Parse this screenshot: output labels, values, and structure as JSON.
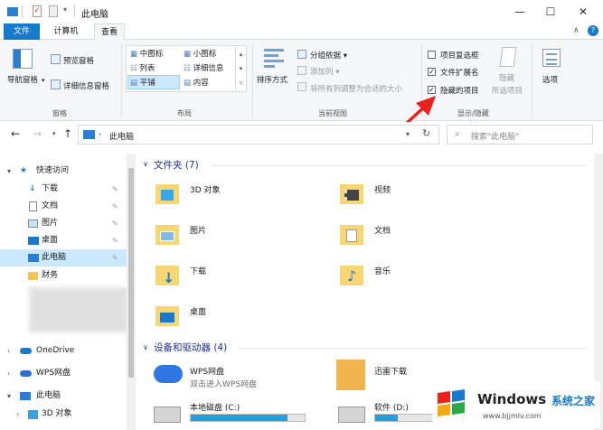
{
  "window": {
    "title": "此电脑"
  },
  "tabs": [
    {
      "label": "文件"
    },
    {
      "label": "计算机"
    },
    {
      "label": "查看"
    }
  ],
  "ribbon": {
    "panes": {
      "label": "窗格",
      "nav_pane": "导航窗格",
      "preview_pane": "预览窗格",
      "details_pane": "详细信息窗格"
    },
    "layout": {
      "label": "布局",
      "items": [
        "中图标",
        "小图标",
        "列表",
        "详细信息",
        "平铺",
        "内容"
      ]
    },
    "current_view": {
      "label": "当前视图",
      "sort_by": "排序方式",
      "group_by": "分组依据",
      "add_column": "添加列",
      "fit_columns": "将所有列调整为合适的大小"
    },
    "show_hide": {
      "label": "显示/隐藏",
      "item_checkboxes": "项目复选框",
      "file_extensions": "文件扩展名",
      "hidden_items": "隐藏的项目",
      "hide": "隐藏",
      "selected_items": "所选项目",
      "options": "选项"
    }
  },
  "checkboxes": {
    "item_checkboxes": false,
    "file_extensions": true,
    "hidden_items": true
  },
  "address": {
    "path": "此电脑",
    "search_placeholder": "搜索\"此电脑\""
  },
  "nav": {
    "items": [
      {
        "label": "快速访问"
      },
      {
        "label": "下载"
      },
      {
        "label": "文档"
      },
      {
        "label": "图片"
      },
      {
        "label": "桌面"
      },
      {
        "label": "此电脑"
      },
      {
        "label": "财务"
      },
      {
        "label": "OneDrive"
      },
      {
        "label": "WPS网盘"
      },
      {
        "label": "此电脑"
      },
      {
        "label": "3D 对象"
      }
    ]
  },
  "content": {
    "folders_header": "文件夹 (7)",
    "folders": [
      {
        "name": "3D 对象"
      },
      {
        "name": "视频"
      },
      {
        "name": "图片"
      },
      {
        "name": "文档"
      },
      {
        "name": "下载"
      },
      {
        "name": "音乐"
      },
      {
        "name": "桌面"
      }
    ],
    "devices_header": "设备和驱动器 (4)",
    "devices": [
      {
        "name": "WPS网盘",
        "sub": "双击进入WPS网盘"
      },
      {
        "name": "迅雷下载"
      },
      {
        "name": "本地磁盘 (C:)",
        "fill": 0.85
      },
      {
        "name": "软件 (D:)",
        "fill": 0.25
      }
    ]
  },
  "watermark": {
    "brand": "Windows",
    "cn": "系统之家",
    "url": "www.bjjmlv.com"
  },
  "colors": {
    "accent": "#1979ca",
    "arrow": "#e8231f",
    "selection": "#cce8ff"
  }
}
